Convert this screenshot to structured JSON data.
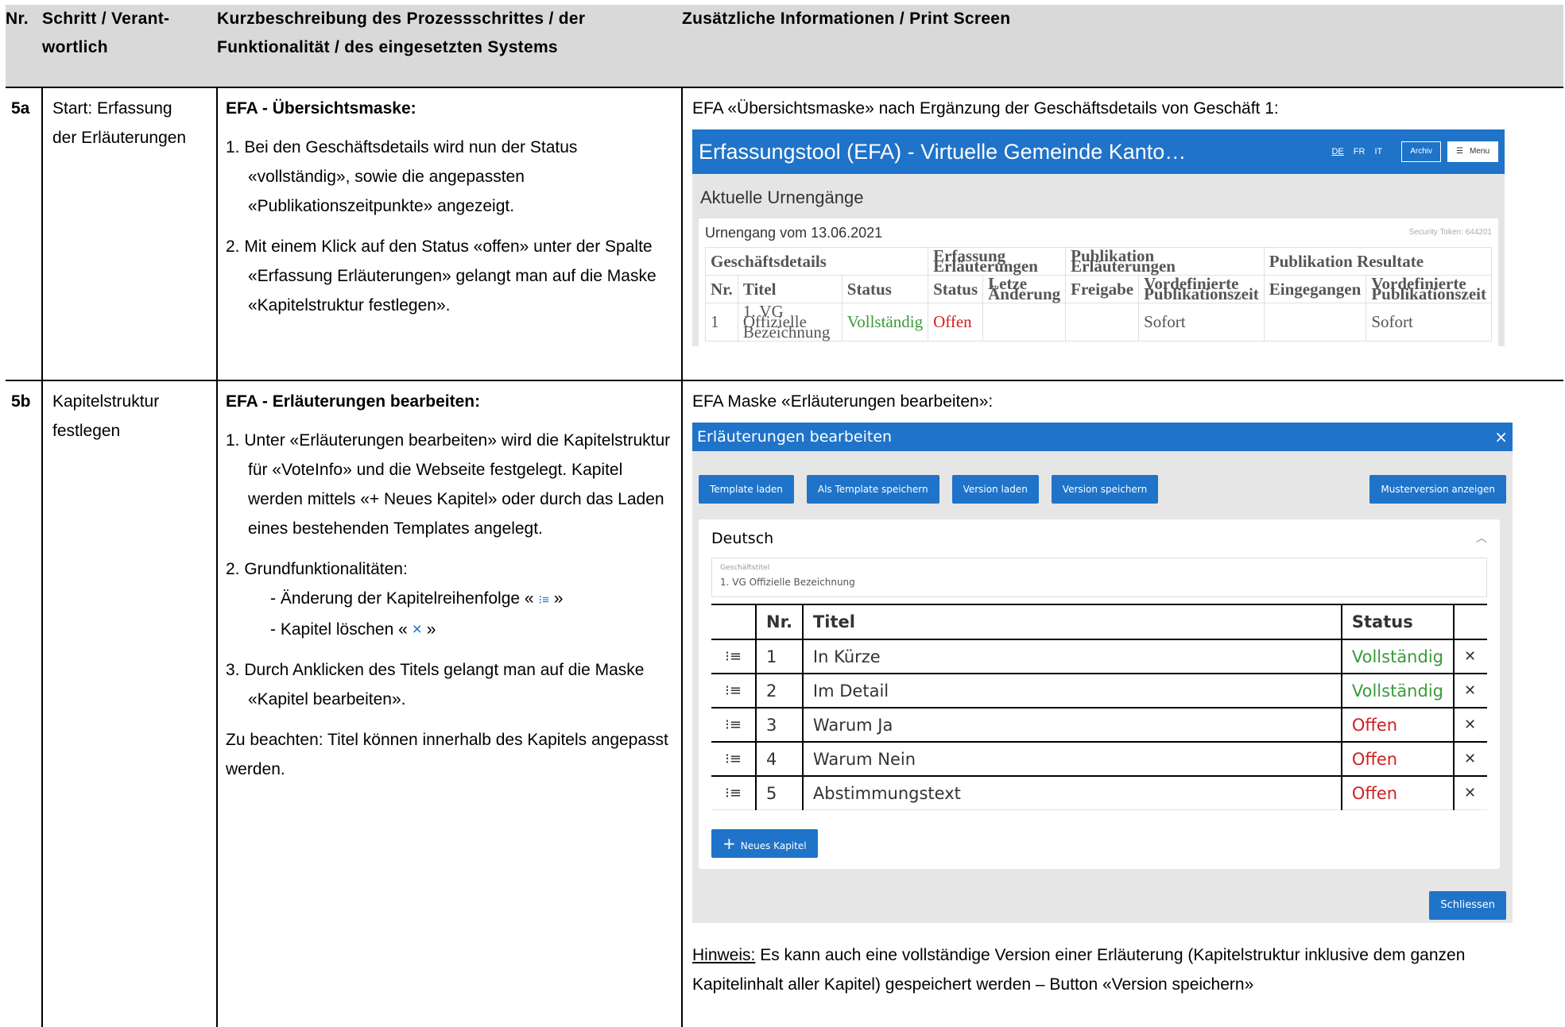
{
  "header": {
    "col1": "Nr.",
    "col2_line1": "Schritt / Verant-",
    "col2_line2": "wortlich",
    "col3_line1": "Kurzbeschreibung des Prozessschrittes / der",
    "col3_line2": "Funktionalität / des eingesetzten Systems",
    "col4": "Zusätzliche Informationen / Print Screen"
  },
  "row_5a": {
    "nr": "5a",
    "step_line1": "Start: Erfassung",
    "step_line2": "der Erläuterungen",
    "desc_title": "EFA - Übersichtsmaske:",
    "items": [
      "1. Bei den Geschäftsdetails wird nun der Status «vollständig», sowie die angepassten «Publikationszeitpunkte» angezeigt.",
      "2. Mit einem Klick auf den Status «offen» unter der Spalte «Erfassung Erläuterungen» gelangt man auf die Maske «Kapitelstruktur festlegen»."
    ],
    "info": "EFA «Übersichtsmaske» nach Ergänzung der Geschäftsdetails von Geschäft 1:",
    "shot": {
      "title": "Erfassungstool (EFA) - Virtuelle Gemeinde Kanto…",
      "langs": [
        "DE",
        "FR",
        "IT"
      ],
      "archiv": "Archiv",
      "menu": "Menu",
      "page_title": "Aktuelle Urnengänge",
      "card_title": "Urnengang vom 13.06.2021",
      "token": "Security Token: 644201",
      "groups": [
        "Geschäftsdetails",
        "Erfassung Erläuterungen",
        "Publikation Erläuterungen",
        "Publikation Resultate"
      ],
      "cols": [
        "Nr.",
        "Titel",
        "Status",
        "Status",
        "Letze Änderung",
        "Freigabe",
        "Vordefinierte Publikationszeit",
        "Eingegangen",
        "Vordefinierte Publikationszeit"
      ],
      "row": [
        "1",
        "1. VG Offizielle Bezeichnung",
        "Vollständig",
        "Offen",
        "",
        "",
        "Sofort",
        "",
        "Sofort"
      ]
    }
  },
  "row_5b": {
    "nr": "5b",
    "step_line1": "Kapitelstruktur",
    "step_line2": "festlegen",
    "desc_title": "EFA - Erläuterungen bearbeiten:",
    "item1": "1. Unter «Erläuterungen bearbeiten» wird die Kapitelstruktur für «VoteInfo» und die Webseite festgelegt. Kapitel werden mittels «+ Neues Kapitel» oder durch das Laden eines bestehenden Templates angelegt.",
    "item2_head": "2. Grundfunktionalitäten:",
    "item2_a_pre": "- Änderung der Kapitelreihenfolge « ",
    "item2_a_icon": "⁝≡",
    "item2_a_post": " »",
    "item2_b_pre": "- Kapitel löschen « ",
    "item2_b_icon": "×",
    "item2_b_post": " »",
    "item3": "3. Durch Anklicken des Titels gelangt man auf die Maske «Kapitel bearbeiten».",
    "note_desc": "Zu beachten: Titel können innerhalb des Kapitels angepasst werden.",
    "info": "EFA Maske «Erläuterungen bearbeiten»:",
    "shot": {
      "title": "Erläuterungen bearbeiten",
      "close_x": "×",
      "buttons": [
        "Template laden",
        "Als Template speichern",
        "Version laden",
        "Version speichern"
      ],
      "button_right": "Musterversion anzeigen",
      "panel_title": "Deutsch",
      "field_label": "Geschäftstitel",
      "field_value": "1. VG Offizielle Bezeichnung",
      "cols": [
        "Nr.",
        "Titel",
        "Status"
      ],
      "rows": [
        {
          "nr": "1",
          "titel": "In Kürze",
          "status": "Vollständig"
        },
        {
          "nr": "2",
          "titel": "Im Detail",
          "status": "Vollständig"
        },
        {
          "nr": "3",
          "titel": "Warum Ja",
          "status": "Offen"
        },
        {
          "nr": "4",
          "titel": "Warum Nein",
          "status": "Offen"
        },
        {
          "nr": "5",
          "titel": "Abstimmungstext",
          "status": "Offen"
        }
      ],
      "add_label": "Neues Kapitel",
      "close_label": "Schliessen"
    },
    "hint_label": "Hinweis:",
    "hint_text": " Es kann auch eine vollständige Version einer Erläuterung (Kapitelstruktur inklusive dem ganzen Kapitelinhalt aller Kapitel) gespeichert werden – Button «Version speichern»"
  }
}
